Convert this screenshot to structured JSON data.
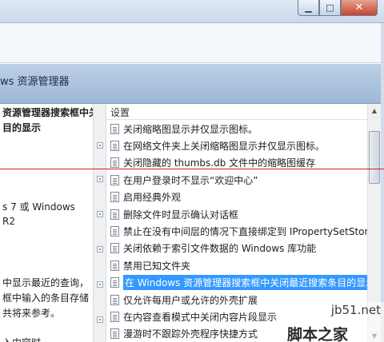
{
  "window": {
    "minimize_glyph": "▁",
    "maximize_glyph": "□",
    "close_glyph": "✕"
  },
  "banner": {
    "title": "ws 资源管理器"
  },
  "description": {
    "title": "资源管理器搜索框中关\n目的显示",
    "lines": [
      "s 7 或 Windows",
      "R2",
      "中显示最近的查询，",
      "框中输入的条目存储",
      "共将来参考。",
      "入内容时，"
    ]
  },
  "list": {
    "column_header": "设置",
    "rows": [
      {
        "label": "关闭缩略图显示并仅显示图标。",
        "selected": false
      },
      {
        "label": "在网络文件夹上关闭缩略图显示并仅显示图标。",
        "selected": false
      },
      {
        "label": "关闭隐藏的 thumbs.db 文件中的缩略图缓存",
        "selected": false
      },
      {
        "label": "在用户登录时不显示“欢迎中心”",
        "selected": false
      },
      {
        "label": "启用经典外观",
        "selected": false
      },
      {
        "label": "删除文件时显示确认对话框",
        "selected": false
      },
      {
        "label": "禁止在没有中间层的情况下直接绑定到 IPropertySetStor",
        "selected": false
      },
      {
        "label": "关闭依赖于索引文件数据的 Windows 库功能",
        "selected": false
      },
      {
        "label": "禁用已知文件夹",
        "selected": false
      },
      {
        "label": "在 Windows 资源管理器搜索框中关闭最近搜索条目的显示",
        "selected": true
      },
      {
        "label": "仅允许每用户或允许的外壳扩展",
        "selected": false
      },
      {
        "label": "在内容查看模式中关闭内容片段显示",
        "selected": false
      },
      {
        "label": "漫游时不跟踪外壳程序快捷方式",
        "selected": false
      }
    ]
  },
  "scrollbar": {
    "up_glyph": "▲",
    "down_glyph": "▼"
  },
  "watermark": {
    "site": "jb51.net",
    "name": "脚本之家"
  }
}
